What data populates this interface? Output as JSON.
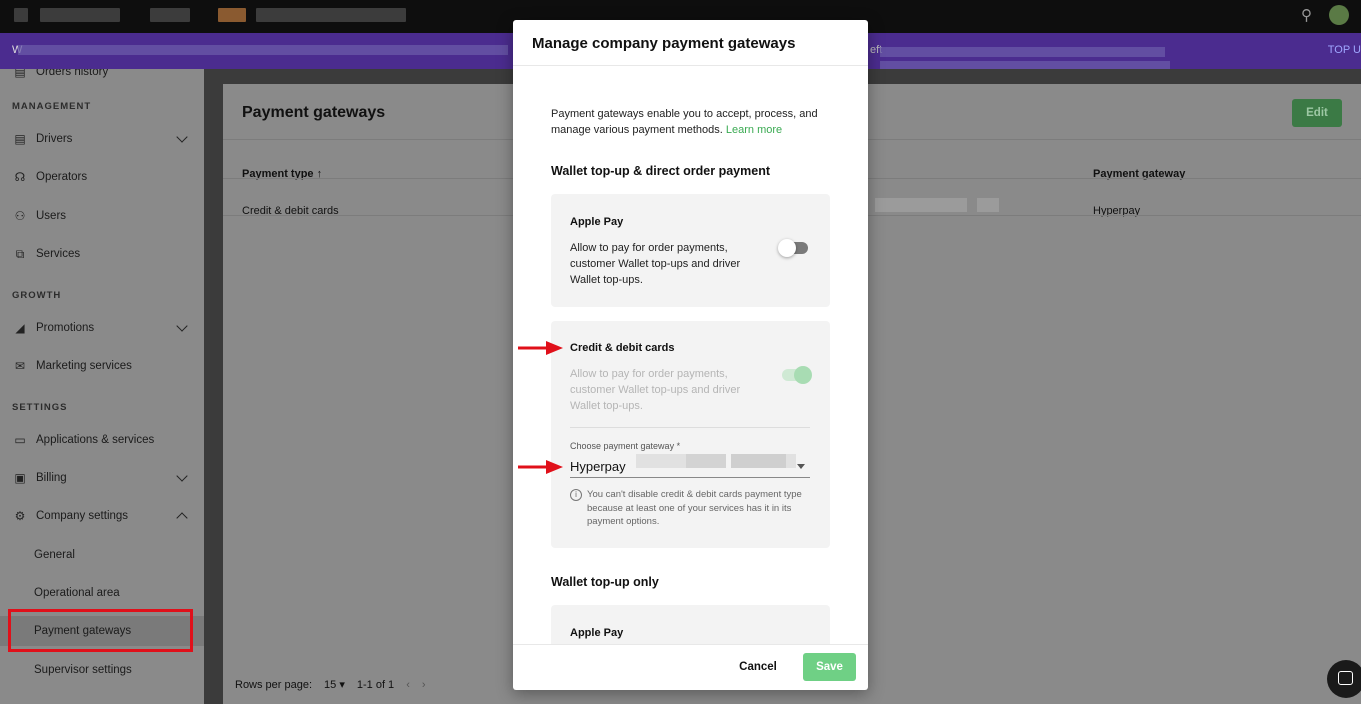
{
  "banner": {
    "left_text": "W",
    "mid_text": "eft",
    "topup_label": "TOP U"
  },
  "sidebar": {
    "partial_item": "Orders history",
    "sections": {
      "management": "MANAGEMENT",
      "growth": "GROWTH",
      "settings": "SETTINGS"
    },
    "items": {
      "drivers": "Drivers",
      "operators": "Operators",
      "users": "Users",
      "services": "Services",
      "promotions": "Promotions",
      "marketing": "Marketing services",
      "applications": "Applications & services",
      "billing": "Billing",
      "company_settings": "Company settings",
      "general": "General",
      "operational_area": "Operational area",
      "payment_gateways": "Payment gateways",
      "supervisor_settings": "Supervisor settings"
    }
  },
  "page": {
    "title": "Payment gateways",
    "edit_label": "Edit",
    "columns": {
      "payment_type": "Payment type",
      "sort_glyph": "↑",
      "payment_gateway": "Payment gateway"
    },
    "rows": [
      {
        "payment_type": "Credit & debit cards",
        "gateway": "Hyperpay"
      }
    ],
    "pager": {
      "rows_per_page_label": "Rows per page:",
      "rows_per_page": "15",
      "range": "1-1 of 1"
    }
  },
  "modal": {
    "title": "Manage company payment gateways",
    "intro": "Payment gateways enable you to accept, process, and manage various payment methods.",
    "learn_more": "Learn more",
    "section1": "Wallet top-up & direct order payment",
    "apple_pay": {
      "title": "Apple Pay",
      "desc": "Allow to pay for order payments, customer Wallet top-ups and driver Wallet top-ups.",
      "enabled": false
    },
    "cards": {
      "title": "Credit & debit cards",
      "desc": "Allow to pay for order payments, customer Wallet top-ups and driver Wallet top-ups.",
      "enabled": true,
      "select_label": "Choose payment gateway *",
      "select_value": "Hyperpay",
      "info": "You can't disable credit & debit cards payment type because at least one of your services has it in its payment options."
    },
    "section2": "Wallet top-up only",
    "apple_pay_2": {
      "title": "Apple Pay"
    },
    "cancel_label": "Cancel",
    "save_label": "Save"
  },
  "colors": {
    "accent_green": "#6fd085",
    "banner_purple": "#4b2c8f",
    "highlight_red": "#e0101a"
  }
}
